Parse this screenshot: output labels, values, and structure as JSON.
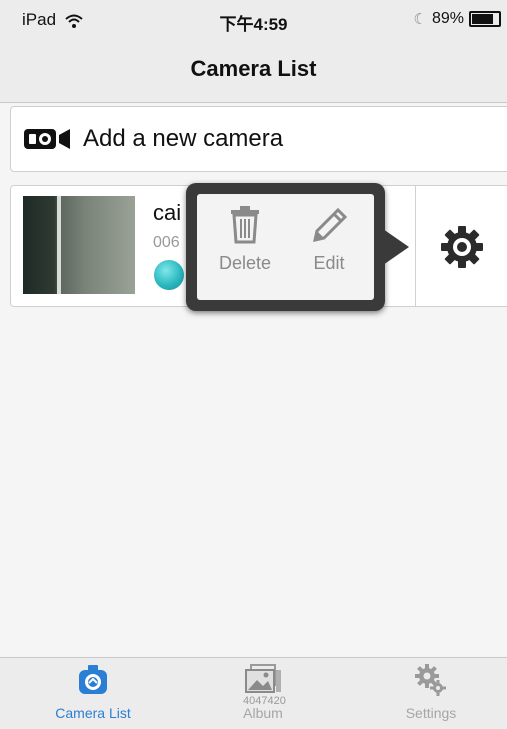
{
  "status_bar": {
    "device": "iPad",
    "time": "下午4:59",
    "battery": "89%",
    "battery_level": 0.89
  },
  "nav": {
    "title": "Camera List"
  },
  "add_camera": {
    "label": "Add a new camera",
    "icon": "video-camera-icon"
  },
  "camera": {
    "name": "cai",
    "id": "006",
    "status_color": "#2bb8c0"
  },
  "popover": {
    "delete_label": "Delete",
    "edit_label": "Edit"
  },
  "tabs": [
    {
      "label": "Camera List",
      "icon": "camera-icon",
      "active": true
    },
    {
      "label": "Album",
      "icon": "album-icon",
      "active": false
    },
    {
      "label": "Settings",
      "icon": "gears-icon",
      "active": false
    }
  ],
  "watermark": "4047420",
  "colors": {
    "accent": "#2a7fd4",
    "bar_bg": "#ececec"
  }
}
